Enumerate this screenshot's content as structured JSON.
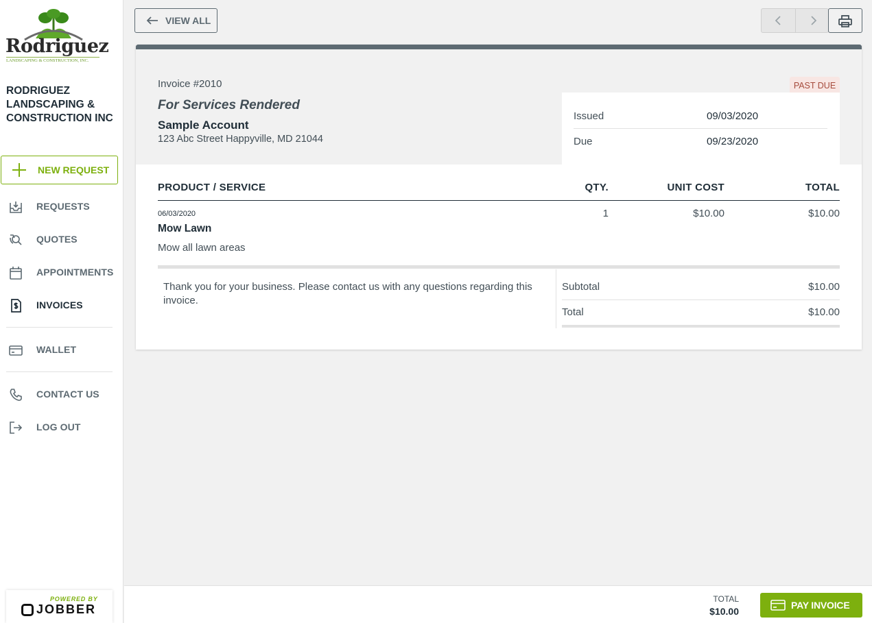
{
  "brand": {
    "logo_text": "Rodriguez",
    "logo_subtext": "LANDSCAPING & CONSTRUCTION, INC.",
    "company_name": "RODRIGUEZ LANDSCAPING & CONSTRUCTION INC",
    "accent_color": "#7db00e"
  },
  "sidebar": {
    "new_request_label": "NEW REQUEST",
    "items": [
      {
        "label": "REQUESTS",
        "icon": "inbox-download-icon"
      },
      {
        "label": "QUOTES",
        "icon": "quote-magnifier-icon"
      },
      {
        "label": "APPOINTMENTS",
        "icon": "calendar-icon"
      },
      {
        "label": "INVOICES",
        "icon": "dollar-document-icon",
        "active": true
      },
      {
        "label": "WALLET",
        "icon": "credit-card-icon"
      },
      {
        "label": "CONTACT US",
        "icon": "phone-icon"
      },
      {
        "label": "LOG OUT",
        "icon": "logout-icon"
      }
    ],
    "powered_by": "POWERED BY",
    "powered_brand": "JOBBER"
  },
  "toolbar": {
    "view_all_label": "VIEW ALL"
  },
  "invoice": {
    "number": "Invoice #2010",
    "subject": "For Services Rendered",
    "status": "PAST DUE",
    "client_name": "Sample Account",
    "client_address": "123 Abc Street Happyville, MD 21044",
    "dates": {
      "issued_label": "Issued",
      "issued_value": "09/03/2020",
      "due_label": "Due",
      "due_value": "09/23/2020"
    },
    "columns": {
      "product": "PRODUCT / SERVICE",
      "qty": "QTY.",
      "unit_cost": "UNIT COST",
      "total": "TOTAL"
    },
    "line_items": [
      {
        "date": "06/03/2020",
        "name": "Mow Lawn",
        "description": "Mow all lawn areas",
        "qty": "1",
        "unit_cost": "$10.00",
        "total": "$10.00"
      }
    ],
    "message": "Thank you for your business. Please contact us with any questions regarding this invoice.",
    "totals": {
      "subtotal_label": "Subtotal",
      "subtotal_value": "$10.00",
      "total_label": "Total",
      "total_value": "$10.00"
    }
  },
  "footer": {
    "total_label": "TOTAL",
    "total_value": "$10.00",
    "pay_label": "PAY INVOICE"
  }
}
